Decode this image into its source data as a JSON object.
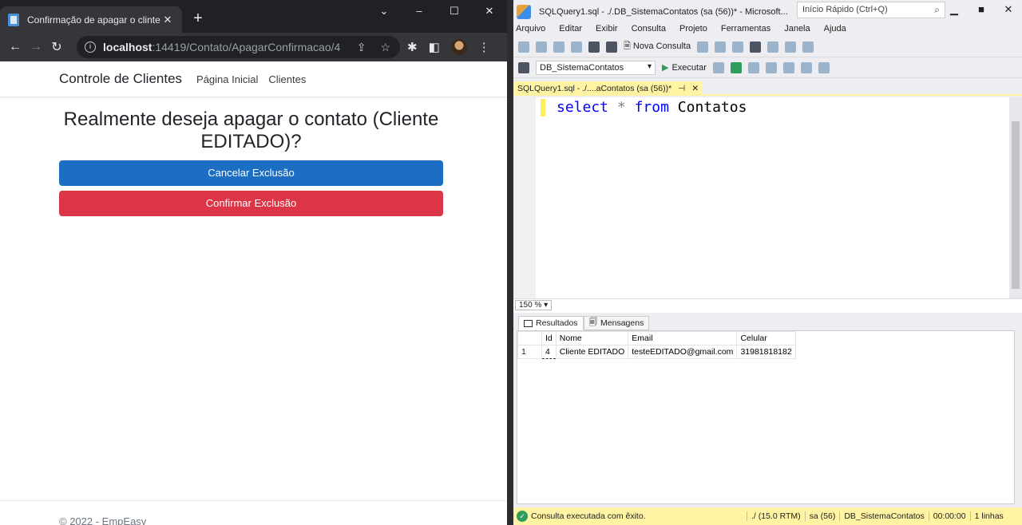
{
  "browser": {
    "tab_title": "Confirmação de apagar o clinte -",
    "url_host": "localhost",
    "url_path": ":14419/Contato/ApagarConfirmacao/4"
  },
  "site": {
    "brand": "Controle de Clientes",
    "nav": [
      "Página Inicial",
      "Clientes"
    ],
    "heading": "Realmente deseja apagar o contato (Cliente EDITADO)?",
    "cancel_label": "Cancelar Exclusão",
    "confirm_label": "Confirmar Exclusão",
    "footer": "© 2022 - EmpEasy"
  },
  "ssms": {
    "title": "SQLQuery1.sql - ./.DB_SistemaContatos (sa (56))* - Microsoft...",
    "quick_launch": "Início Rápido (Ctrl+Q)",
    "menu": [
      "Arquivo",
      "Editar",
      "Exibir",
      "Consulta",
      "Projeto",
      "Ferramentas",
      "Janela",
      "Ajuda"
    ],
    "nova_consulta": "Nova Consulta",
    "database": "DB_SistemaContatos",
    "executar": "Executar",
    "doc_tab": "SQLQuery1.sql - ./....aContatos (sa (56))*",
    "query": {
      "select": "select",
      "star": "*",
      "from": "from",
      "table": "Contatos"
    },
    "zoom": "150 %",
    "result_tabs": [
      "Resultados",
      "Mensagens"
    ],
    "columns": [
      "Id",
      "Nome",
      "Email",
      "Celular"
    ],
    "rows": [
      {
        "rownum": "1",
        "Id": "4",
        "Nome": "Cliente EDITADO",
        "Email": "testeEDITADO@gmail.com",
        "Celular": "31981818182"
      }
    ],
    "status": {
      "message": "Consulta executada com êxito.",
      "server": "./ (15.0 RTM)",
      "user": "sa (56)",
      "db": "DB_SistemaContatos",
      "time": "00:00:00",
      "rows": "1 linhas"
    }
  }
}
